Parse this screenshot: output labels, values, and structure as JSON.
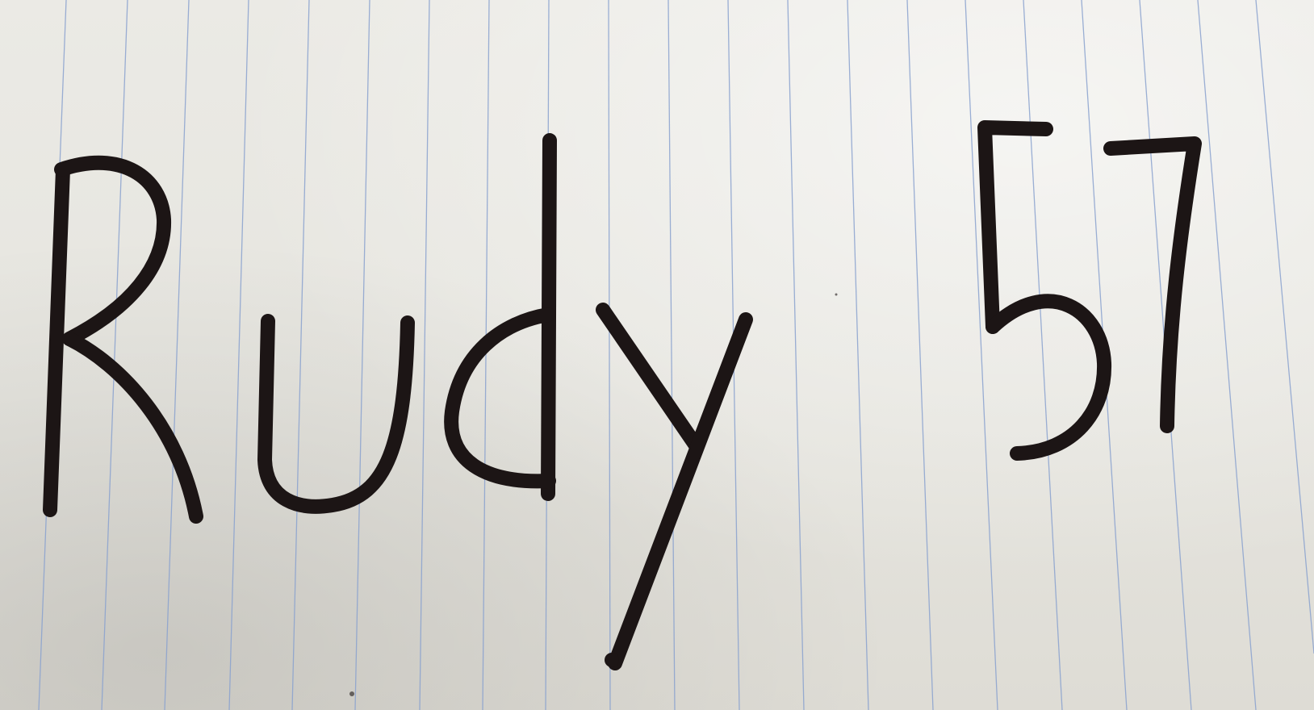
{
  "handwriting": {
    "word": "Rudy",
    "number": "57"
  },
  "colors": {
    "paper": "#e8e7e1",
    "rule_line": "#8aa2cf",
    "ink": "#1c1515"
  }
}
